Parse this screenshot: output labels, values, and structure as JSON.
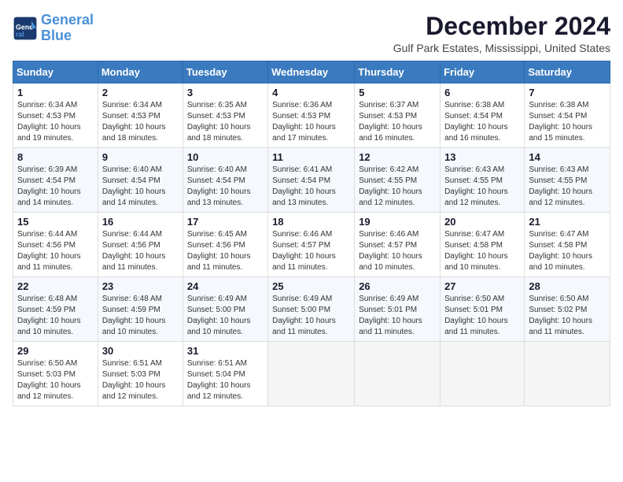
{
  "logo": {
    "text_general": "General",
    "text_blue": "Blue"
  },
  "title": {
    "month": "December 2024",
    "location": "Gulf Park Estates, Mississippi, United States"
  },
  "days_of_week": [
    "Sunday",
    "Monday",
    "Tuesday",
    "Wednesday",
    "Thursday",
    "Friday",
    "Saturday"
  ],
  "weeks": [
    [
      {
        "day": "1",
        "sunrise": "6:34 AM",
        "sunset": "4:53 PM",
        "daylight": "10 hours and 19 minutes."
      },
      {
        "day": "2",
        "sunrise": "6:34 AM",
        "sunset": "4:53 PM",
        "daylight": "10 hours and 18 minutes."
      },
      {
        "day": "3",
        "sunrise": "6:35 AM",
        "sunset": "4:53 PM",
        "daylight": "10 hours and 18 minutes."
      },
      {
        "day": "4",
        "sunrise": "6:36 AM",
        "sunset": "4:53 PM",
        "daylight": "10 hours and 17 minutes."
      },
      {
        "day": "5",
        "sunrise": "6:37 AM",
        "sunset": "4:53 PM",
        "daylight": "10 hours and 16 minutes."
      },
      {
        "day": "6",
        "sunrise": "6:38 AM",
        "sunset": "4:54 PM",
        "daylight": "10 hours and 16 minutes."
      },
      {
        "day": "7",
        "sunrise": "6:38 AM",
        "sunset": "4:54 PM",
        "daylight": "10 hours and 15 minutes."
      }
    ],
    [
      {
        "day": "8",
        "sunrise": "6:39 AM",
        "sunset": "4:54 PM",
        "daylight": "10 hours and 14 minutes."
      },
      {
        "day": "9",
        "sunrise": "6:40 AM",
        "sunset": "4:54 PM",
        "daylight": "10 hours and 14 minutes."
      },
      {
        "day": "10",
        "sunrise": "6:40 AM",
        "sunset": "4:54 PM",
        "daylight": "10 hours and 13 minutes."
      },
      {
        "day": "11",
        "sunrise": "6:41 AM",
        "sunset": "4:54 PM",
        "daylight": "10 hours and 13 minutes."
      },
      {
        "day": "12",
        "sunrise": "6:42 AM",
        "sunset": "4:55 PM",
        "daylight": "10 hours and 12 minutes."
      },
      {
        "day": "13",
        "sunrise": "6:43 AM",
        "sunset": "4:55 PM",
        "daylight": "10 hours and 12 minutes."
      },
      {
        "day": "14",
        "sunrise": "6:43 AM",
        "sunset": "4:55 PM",
        "daylight": "10 hours and 12 minutes."
      }
    ],
    [
      {
        "day": "15",
        "sunrise": "6:44 AM",
        "sunset": "4:56 PM",
        "daylight": "10 hours and 11 minutes."
      },
      {
        "day": "16",
        "sunrise": "6:44 AM",
        "sunset": "4:56 PM",
        "daylight": "10 hours and 11 minutes."
      },
      {
        "day": "17",
        "sunrise": "6:45 AM",
        "sunset": "4:56 PM",
        "daylight": "10 hours and 11 minutes."
      },
      {
        "day": "18",
        "sunrise": "6:46 AM",
        "sunset": "4:57 PM",
        "daylight": "10 hours and 11 minutes."
      },
      {
        "day": "19",
        "sunrise": "6:46 AM",
        "sunset": "4:57 PM",
        "daylight": "10 hours and 10 minutes."
      },
      {
        "day": "20",
        "sunrise": "6:47 AM",
        "sunset": "4:58 PM",
        "daylight": "10 hours and 10 minutes."
      },
      {
        "day": "21",
        "sunrise": "6:47 AM",
        "sunset": "4:58 PM",
        "daylight": "10 hours and 10 minutes."
      }
    ],
    [
      {
        "day": "22",
        "sunrise": "6:48 AM",
        "sunset": "4:59 PM",
        "daylight": "10 hours and 10 minutes."
      },
      {
        "day": "23",
        "sunrise": "6:48 AM",
        "sunset": "4:59 PM",
        "daylight": "10 hours and 10 minutes."
      },
      {
        "day": "24",
        "sunrise": "6:49 AM",
        "sunset": "5:00 PM",
        "daylight": "10 hours and 10 minutes."
      },
      {
        "day": "25",
        "sunrise": "6:49 AM",
        "sunset": "5:00 PM",
        "daylight": "10 hours and 11 minutes."
      },
      {
        "day": "26",
        "sunrise": "6:49 AM",
        "sunset": "5:01 PM",
        "daylight": "10 hours and 11 minutes."
      },
      {
        "day": "27",
        "sunrise": "6:50 AM",
        "sunset": "5:01 PM",
        "daylight": "10 hours and 11 minutes."
      },
      {
        "day": "28",
        "sunrise": "6:50 AM",
        "sunset": "5:02 PM",
        "daylight": "10 hours and 11 minutes."
      }
    ],
    [
      {
        "day": "29",
        "sunrise": "6:50 AM",
        "sunset": "5:03 PM",
        "daylight": "10 hours and 12 minutes."
      },
      {
        "day": "30",
        "sunrise": "6:51 AM",
        "sunset": "5:03 PM",
        "daylight": "10 hours and 12 minutes."
      },
      {
        "day": "31",
        "sunrise": "6:51 AM",
        "sunset": "5:04 PM",
        "daylight": "10 hours and 12 minutes."
      },
      null,
      null,
      null,
      null
    ]
  ]
}
